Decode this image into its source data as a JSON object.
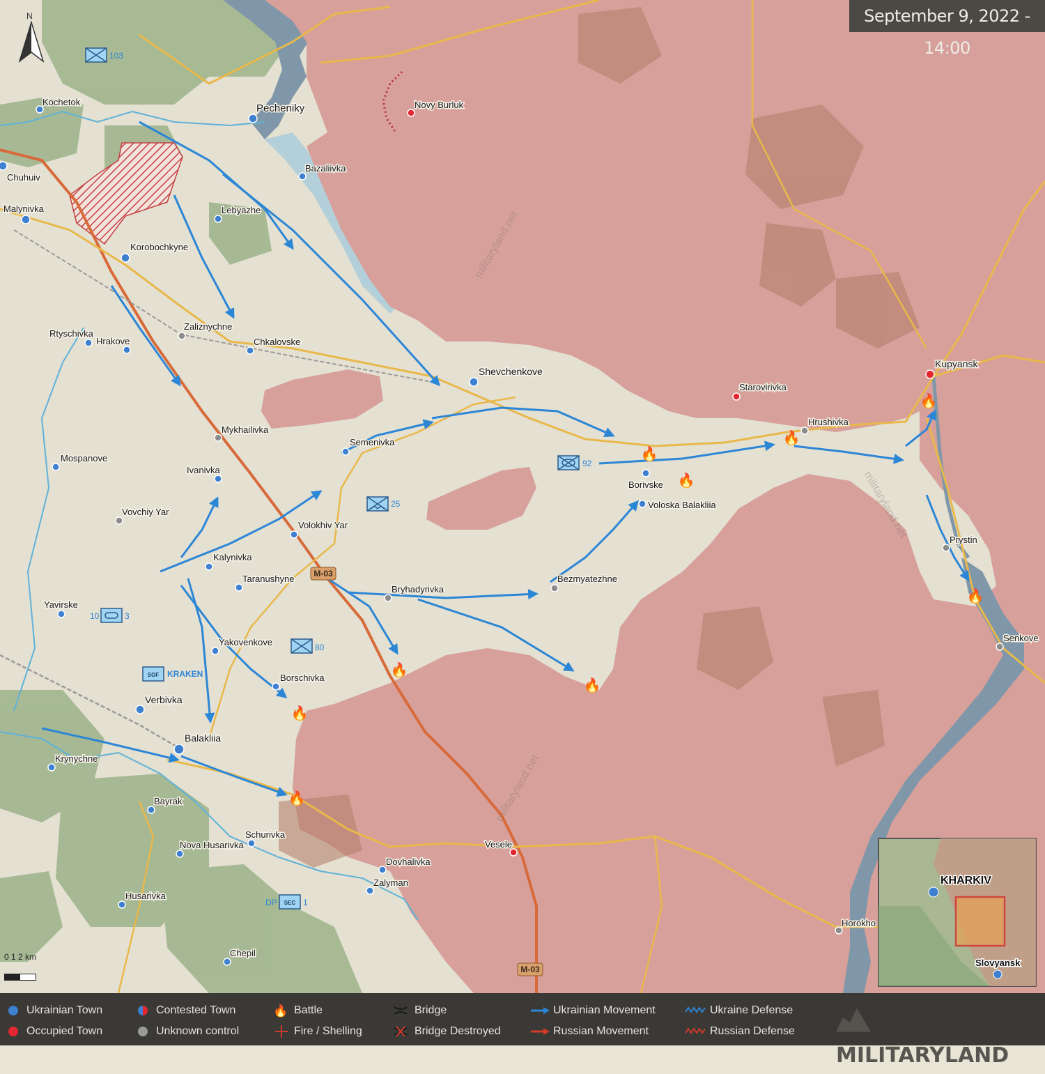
{
  "date_stamp": "September 9, 2022 - 14:00",
  "north_arrow_label": "N",
  "scale_label": "0  1  2 km",
  "brand_text": "MILITARYLAND",
  "watermark": "militaryland.net",
  "colors": {
    "occupied": "#d7a09b",
    "liberated_zone": "#ebe7d8",
    "base_land": "#e4e0d2",
    "forest": "#8ea77e",
    "water": "#7f97a8",
    "river_blue": "#5fb2d8",
    "ukraine_arrow": "#2c86d6",
    "road_main": "#d86a3a",
    "road_secondary": "#e9b84a",
    "ukrainian_town": "#3d7fd0",
    "occupied_town": "#e3262f",
    "unknown_town": "#8c8c8c",
    "legend_bg": "#3a3936"
  },
  "towns": {
    "ukrainian": [
      "Chuhuiv",
      "Malynivka",
      "Korobochkyne",
      "Pecheniky",
      "Bazaliivka",
      "Lebyazhe",
      "Shevchenkove",
      "Kochetok",
      "Rtyschivka",
      "Hrakove",
      "Chkalovske",
      "Semenivka",
      "Mospanove",
      "Ivanivka",
      "Volokhiv Yar",
      "Kalynivka",
      "Taranushyne",
      "Yavirske",
      "Yakovenkove",
      "Borschivka",
      "Verbivka",
      "Balakliia",
      "Krynychne",
      "Bayrak",
      "Schurivka",
      "Nova Husarivka",
      "Husarivka",
      "Dovhalivka",
      "Zalyman",
      "Chepil",
      "Borivske",
      "Voloska Balakliia"
    ],
    "occupied": [
      "Novy Burluk",
      "Starovirivka",
      "Kupyansk",
      "Vesele"
    ],
    "unknown": [
      "Zaliznychne",
      "Mykhailivka",
      "Vovchiy Yar",
      "Bryhadyrivka",
      "Bezmyatezhne",
      "Hrushivka",
      "Prystin",
      "Senkove",
      "Horokhovatka"
    ]
  },
  "town_labels": {
    "kochetok": "Kochetok",
    "pecheniky": "Pecheniky",
    "novy_burluk": "Novy Burluk",
    "chuhuiv": "Chuhuiv",
    "bazaliivka": "Bazaliivka",
    "malynivka": "Malynivka",
    "lebyazhe": "Lebyazhe",
    "korobochkyne": "Korobochkyne",
    "zaliznychne": "Zaliznychne",
    "rtyschivka": "Rtyschivka",
    "hrakove": "Hrakove",
    "chkalovske": "Chkalovske",
    "shevchenkove": "Shevchenkove",
    "starovirivka": "Starovirivka",
    "kupyansk": "Kupyansk",
    "hrushivka": "Hrushivka",
    "mykhailivka": "Mykhailivka",
    "semenivka": "Semenivka",
    "mospanove": "Mospanove",
    "ivanivka": "Ivanivka",
    "borivske": "Borivske",
    "voloska_balakliia": "Voloska Balakliia",
    "vovchiy_yar": "Vovchiy Yar",
    "volokhiv_yar": "Volokhiv Yar",
    "prystin": "Prystin",
    "kalynivka": "Kalynivka",
    "taranushyne": "Taranushyne",
    "bezmyatezhne": "Bezmyatezhne",
    "bryhadyrivka": "Bryhadyrivka",
    "yavirske": "Yavirske",
    "senkove": "Senkove",
    "yakovenkove": "Yakovenkove",
    "borschivka": "Borschivka",
    "verbivka": "Verbivka",
    "balakliia": "Balakliia",
    "krynychne": "Krynychne",
    "bayrak": "Bayrak",
    "schurivka": "Schurivka",
    "nova_husarivka": "Nova Husarivka",
    "vesele": "Vesele",
    "dovhalivka": "Dovhalivka",
    "zalyman": "Zalyman",
    "husarivka": "Husarivka",
    "horokhovatka": "Horokho",
    "chepil": "Chepil"
  },
  "roads": {
    "m03_upper": "M-03",
    "m03_lower": "M-03"
  },
  "units": {
    "u103": "103",
    "u92": "92",
    "u25": "25",
    "u80": "80",
    "u10_left": "10",
    "u10_right": "3",
    "sof_symbol": "SOF",
    "kraken": "KRAKEN",
    "dp_prefix": "DP",
    "sec_symbol": "SEC",
    "sec_suffix": "1"
  },
  "inset": {
    "city_top": "KHARKIV",
    "city_bottom": "Slovyansk"
  },
  "legend": {
    "ukrainian_town": "Ukrainian Town",
    "occupied_town": "Occupied Town",
    "contested_town": "Contested Town",
    "unknown_control": "Unknown control",
    "battle": "Battle",
    "fire_shelling": "Fire / Shelling",
    "bridge": "Bridge",
    "bridge_destroyed": "Bridge Destroyed",
    "ukrainian_movement": "Ukrainian Movement",
    "russian_movement": "Russian Movement",
    "ukraine_defense": "Ukraine Defense",
    "russian_defense": "Russian Defense"
  }
}
